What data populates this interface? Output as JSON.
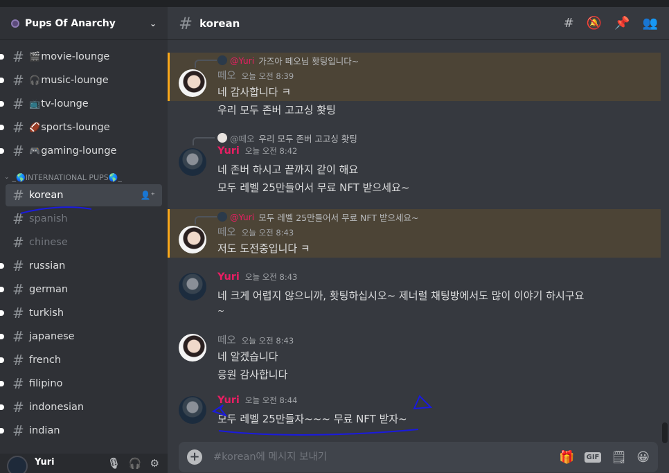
{
  "server": {
    "name": "Pups Of Anarchy"
  },
  "channels": [
    {
      "name": "movie-lounge",
      "emoji": "🎬"
    },
    {
      "name": "music-lounge",
      "emoji": "🎧"
    },
    {
      "name": "tv-lounge",
      "emoji": "📺"
    },
    {
      "name": "sports-lounge",
      "emoji": "🏈"
    },
    {
      "name": "gaming-lounge",
      "emoji": "🎮"
    }
  ],
  "category": {
    "name": "_🌎INTERNATIONAL PUPS🌎_"
  },
  "intl_channels": [
    {
      "name": "korean",
      "state": "selected"
    },
    {
      "name": "spanish",
      "state": "muted"
    },
    {
      "name": "chinese",
      "state": "muted"
    },
    {
      "name": "russian",
      "state": "unread"
    },
    {
      "name": "german",
      "state": "unread"
    },
    {
      "name": "turkish",
      "state": "unread"
    },
    {
      "name": "japanese",
      "state": "unread"
    },
    {
      "name": "french",
      "state": "unread"
    },
    {
      "name": "filipino",
      "state": "unread"
    },
    {
      "name": "indonesian",
      "state": "unread"
    },
    {
      "name": "indian",
      "state": "unread"
    }
  ],
  "user": {
    "name": "Yuri"
  },
  "header": {
    "channel": "korean"
  },
  "messages": {
    "m1": {
      "reply_name": "@Yuri",
      "reply_text": "가즈아 떼오님 홧팅입니다~",
      "author": "떼오",
      "time": "오늘 오전 8:39",
      "lines": [
        "네 감사합니다 ㅋ",
        "우리 모두 존버 고고싱 홧팅"
      ]
    },
    "m2": {
      "reply_name": "@떼오",
      "reply_text": "우리 모두 존버 고고싱 홧팅",
      "author": "Yuri",
      "time": "오늘 오전 8:42",
      "lines": [
        "네 존버 하시고 끝까지 같이 해요",
        "모두 레벨 25만들어서 무료 NFT 받으세요~"
      ]
    },
    "m3": {
      "reply_name": "@Yuri",
      "reply_text": "모두 레벨 25만들어서 무료 NFT 받으세요~",
      "author": "떼오",
      "time": "오늘 오전 8:43",
      "lines": [
        "저도 도전중입니다 ㅋ"
      ]
    },
    "m4": {
      "author": "Yuri",
      "time": "오늘 오전 8:43",
      "lines": [
        "네 크게 어렵지 않으니까, 홧팅하십시오~ 제너럴 채팅방에서도 많이 이야기 하시구요",
        "~"
      ]
    },
    "m5": {
      "author": "떼오",
      "time": "오늘 오전 8:43",
      "lines": [
        "네 알겠습니다",
        "응원 감사합니다"
      ]
    },
    "m6": {
      "author": "Yuri",
      "time": "오늘 오전 8:44",
      "lines": [
        "모두 레벨 25만들자~~~ 무료 NFT 받자~"
      ]
    }
  },
  "composer": {
    "placeholder": "#korean에 메시지 보내기"
  },
  "colors": {
    "yuri": "#e91e63",
    "highlight": "#4c4436",
    "annotation_ink": "#1a1adf"
  }
}
